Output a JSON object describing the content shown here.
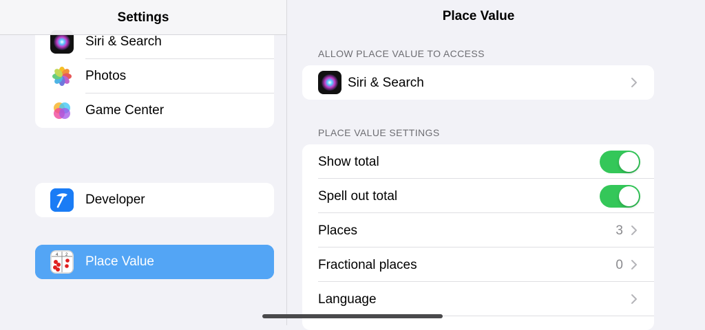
{
  "sidebar": {
    "title": "Settings",
    "group1": [
      {
        "label": "Siri & Search",
        "icon": "siri-icon"
      },
      {
        "label": "Photos",
        "icon": "photos-icon"
      },
      {
        "label": "Game Center",
        "icon": "game-center-icon"
      }
    ],
    "developer": {
      "label": "Developer",
      "icon": "hammer-icon"
    },
    "place_value": {
      "label": "Place Value",
      "icon": "place-value-app-icon",
      "selected": true
    }
  },
  "detail": {
    "title": "Place Value",
    "access_header": "ALLOW PLACE VALUE TO ACCESS",
    "access_rows": [
      {
        "label": "Siri & Search",
        "icon": "siri-icon"
      }
    ],
    "settings_header": "PLACE VALUE SETTINGS",
    "settings": {
      "show_total": {
        "label": "Show total",
        "on": true
      },
      "spell_out_total": {
        "label": "Spell out total",
        "on": true
      },
      "places": {
        "label": "Places",
        "value": "3"
      },
      "fractional_places": {
        "label": "Fractional places",
        "value": "0"
      },
      "language": {
        "label": "Language"
      }
    }
  },
  "colors": {
    "toggle_on": "#34c759",
    "selected_row": "#53a5f5",
    "background": "#f2f2f7"
  }
}
